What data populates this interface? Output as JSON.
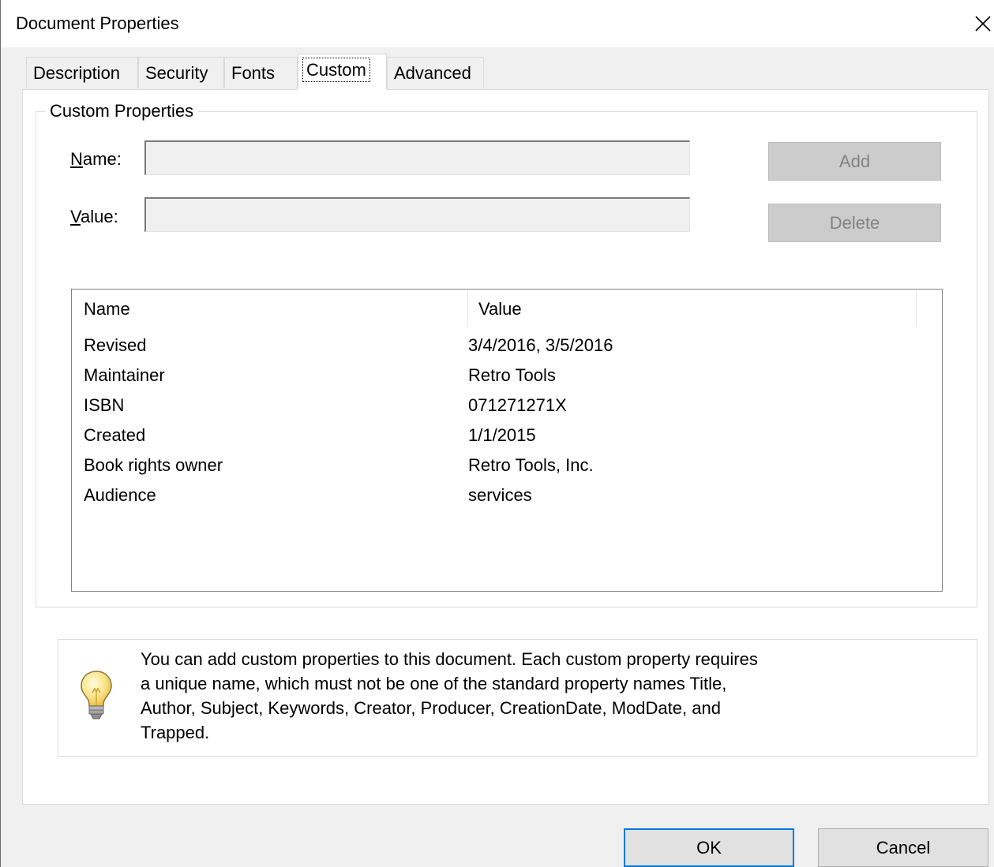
{
  "window": {
    "title": "Document Properties"
  },
  "tabs": [
    {
      "label": "Description",
      "active": false
    },
    {
      "label": "Security",
      "active": false
    },
    {
      "label": "Fonts",
      "active": false
    },
    {
      "label": "Custom",
      "active": true
    },
    {
      "label": "Advanced",
      "active": false
    }
  ],
  "custom": {
    "group_title": "Custom Properties",
    "name_label_key": "N",
    "name_label_rest": "ame:",
    "value_label_key": "V",
    "value_label_rest": "alue:",
    "name_value": "",
    "value_value": "",
    "add_label": "Add",
    "delete_label": "Delete",
    "columns": [
      "Name",
      "Value"
    ],
    "rows": [
      {
        "name": "Revised",
        "value": "3/4/2016, 3/5/2016"
      },
      {
        "name": "Maintainer",
        "value": "Retro Tools"
      },
      {
        "name": "ISBN",
        "value": "071271271X"
      },
      {
        "name": "Created",
        "value": "1/1/2015"
      },
      {
        "name": "Book rights owner",
        "value": "Retro Tools, Inc."
      },
      {
        "name": "Audience",
        "value": "services"
      }
    ]
  },
  "info": {
    "icon": "lightbulb-icon",
    "lines": [
      "You can add custom properties to this document. Each custom property requires",
      "a unique name, which must not be one of the standard property names Title,",
      "Author, Subject, Keywords, Creator, Producer, CreationDate, ModDate, and",
      "Trapped."
    ]
  },
  "footer": {
    "ok_label": "OK",
    "cancel_label": "Cancel"
  },
  "colors": {
    "dialog_bg": "#f0f0f0",
    "default_button_border": "#0078d7",
    "disabled_button_bg": "#cccccc"
  }
}
